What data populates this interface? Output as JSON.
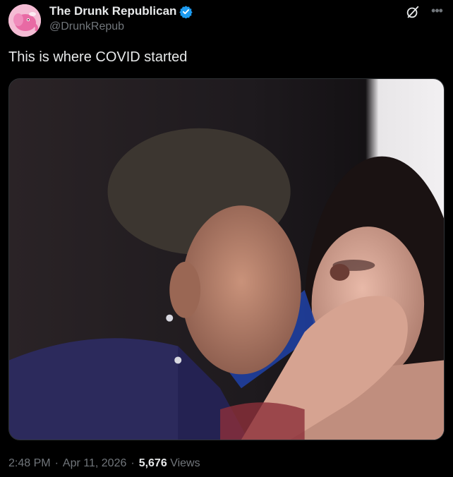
{
  "author": {
    "display_name": "The Drunk Republican",
    "handle": "@DrunkRepub",
    "verified": true,
    "avatar_icon": "pink-elephant-avatar"
  },
  "tweet": {
    "text": "This is where COVID started"
  },
  "meta": {
    "time": "2:48 PM",
    "separator": "·",
    "date": "Apr 11, 2026",
    "views_count": "5,676",
    "views_label": "Views"
  },
  "colors": {
    "background": "#000000",
    "text_primary": "#e7e9ea",
    "text_secondary": "#71767b",
    "verified_blue": "#1d9bf0"
  },
  "icons": {
    "grok": "grok-icon",
    "more": "more-icon",
    "verified": "verified-badge-icon"
  }
}
